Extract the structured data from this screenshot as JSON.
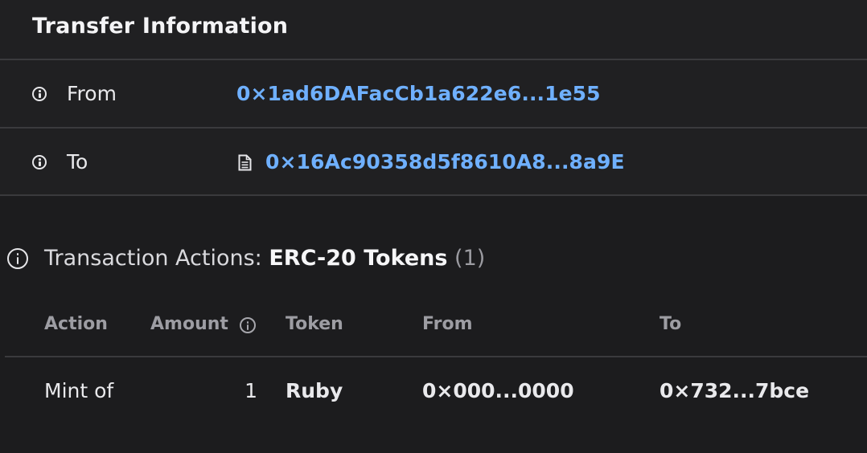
{
  "transfer": {
    "title": "Transfer Information",
    "rows": [
      {
        "label": "From",
        "address": "0×1ad6DAFacCb1a622e6...1e55",
        "has_contract_icon": false
      },
      {
        "label": "To",
        "address": "0×16Ac90358d5f8610A8...8a9E",
        "has_contract_icon": true
      }
    ]
  },
  "actions": {
    "lead": "Transaction Actions:",
    "type": "ERC-20 Tokens",
    "count": "(1)",
    "columns": {
      "action": "Action",
      "amount": "Amount",
      "token": "Token",
      "from": "From",
      "to": "To"
    },
    "rows": [
      {
        "action": "Mint of",
        "amount": "1",
        "token": "Ruby",
        "from": "0×000...0000",
        "to": "0×732...7bce"
      }
    ]
  },
  "colors": {
    "background": "#1c1c1e",
    "panel": "#202022",
    "link": "#6fb0ff",
    "divider": "#3a3a3d",
    "muted": "#9d9da3"
  },
  "icons": {
    "info": "info-circle-icon",
    "contract": "document-icon"
  }
}
